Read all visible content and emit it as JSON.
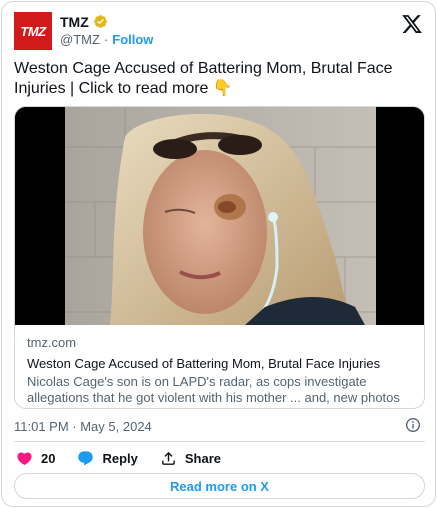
{
  "author": {
    "name": "TMZ",
    "avatar_text": "TMZ",
    "handle": "@TMZ",
    "separator": "·",
    "follow_label": "Follow",
    "verified_color": "#e2b719"
  },
  "tweet": {
    "text": "Weston Cage Accused of Battering Mom, Brutal Face Injuries   |  Click to read more 👇"
  },
  "link_card": {
    "domain": "tmz.com",
    "title": "Weston Cage Accused of Battering Mom, Brutal Face Injuries",
    "description": "Nicolas Cage's son is on LAPD's radar, as cops investigate allegations that he got violent with his mother ... and, new photos capture the brutal ..."
  },
  "meta": {
    "timestamp": "11:01 PM · May 5, 2024"
  },
  "actions": {
    "like_count": "20",
    "reply_label": "Reply",
    "share_label": "Share"
  },
  "footer": {
    "read_more_label": "Read more on X"
  },
  "colors": {
    "accent": "#1d9bf0",
    "brand": "#d11a1a",
    "like": "#f91880"
  },
  "icons": [
    "verified-badge-icon",
    "x-logo-icon",
    "info-icon",
    "heart-icon",
    "reply-bubble-icon",
    "share-icon"
  ]
}
